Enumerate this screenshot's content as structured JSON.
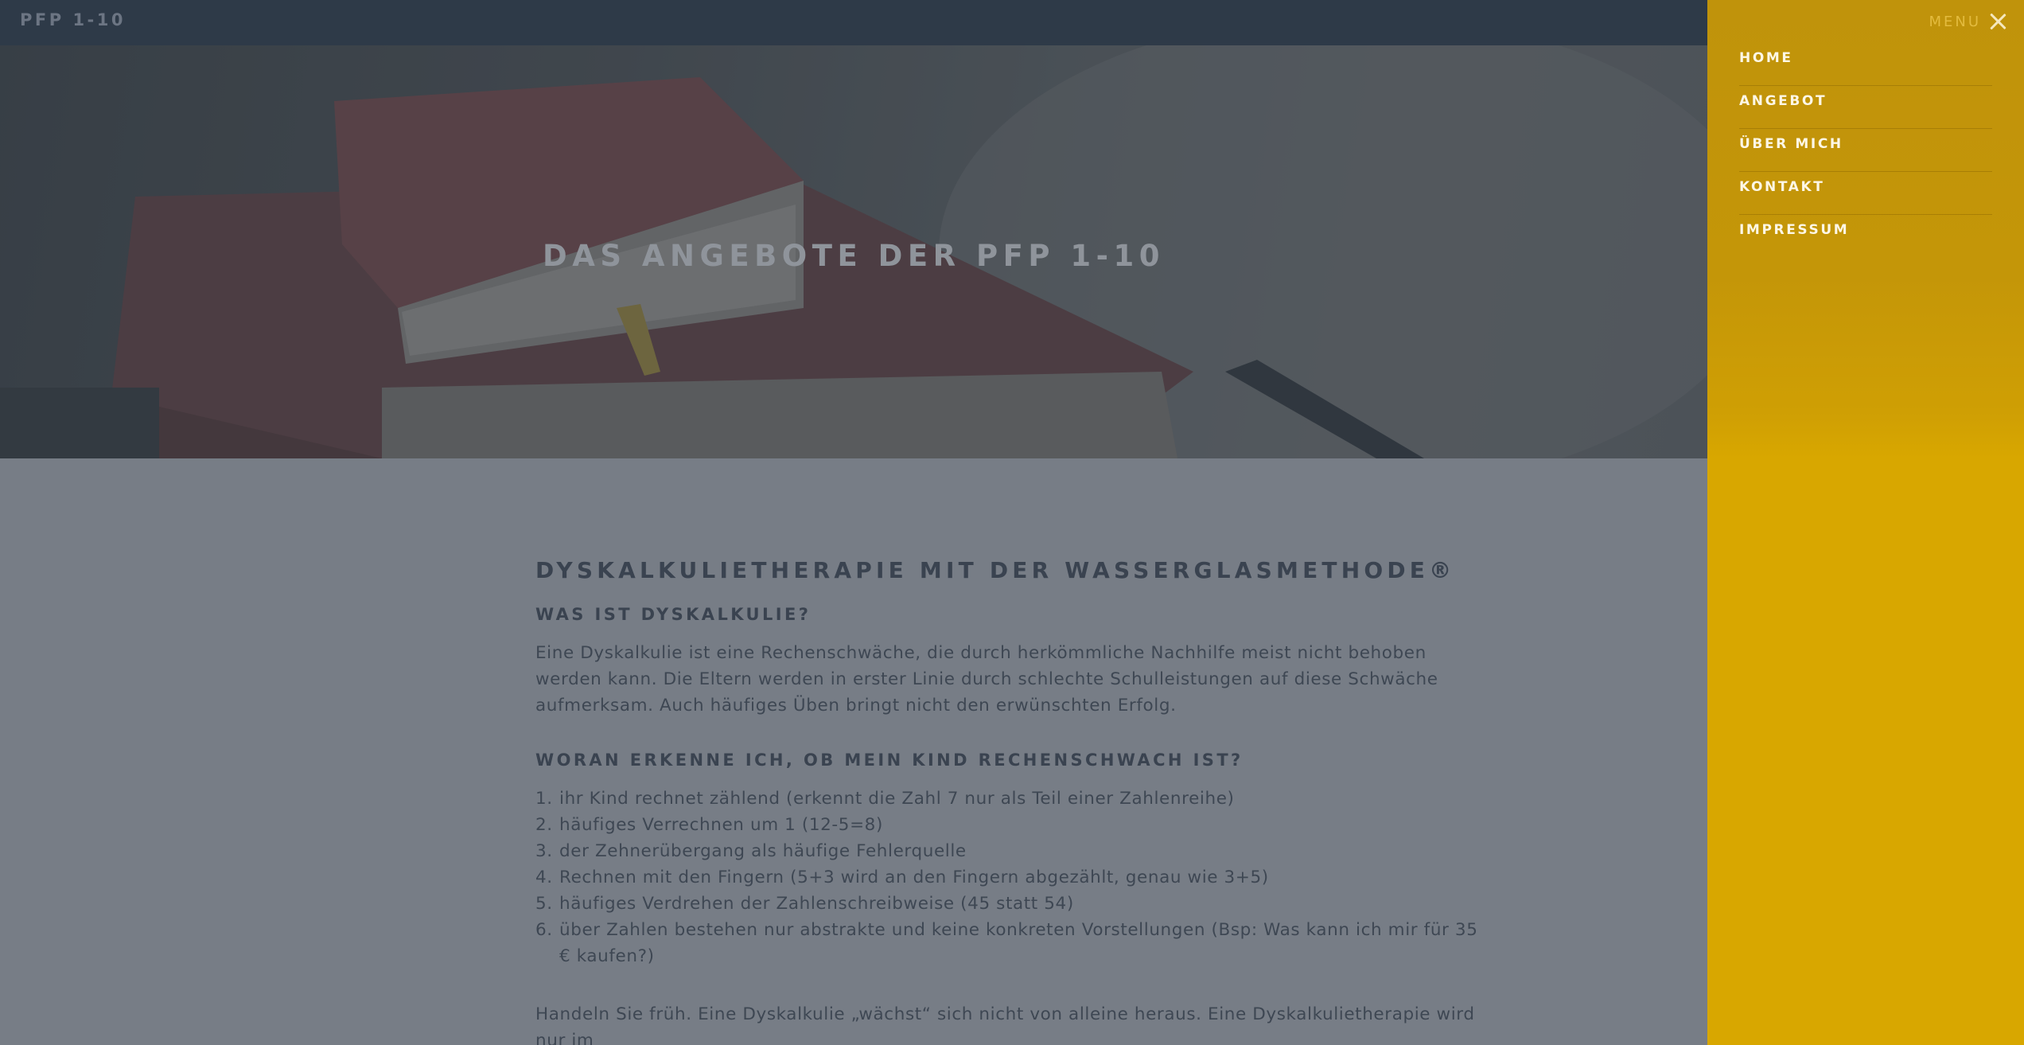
{
  "site": {
    "brand": "PFP 1-10"
  },
  "hero": {
    "title": "DAS ANGEBOTE DER PFP 1-10"
  },
  "menu": {
    "label": "MENU",
    "close_icon": "close-icon",
    "items": [
      {
        "label": "HOME"
      },
      {
        "label": "ANGEBOT"
      },
      {
        "label": "ÜBER MICH"
      },
      {
        "label": "KONTAKT"
      },
      {
        "label": "IMPRESSUM"
      }
    ]
  },
  "content": {
    "heading": "DYSKALKULIETHERAPIE MIT DER WASSERGLASMETHODE®",
    "section1": {
      "heading": "WAS IST DYSKALKULIE?",
      "text": "Eine Dyskalkulie ist eine Rechenschwäche, die durch herkömmliche Nachhilfe meist nicht behoben werden kann. Die Eltern werden in erster Linie durch schlechte Schulleistungen auf diese Schwäche aufmerksam. Auch häufiges Üben bringt nicht den erwünschten Erfolg."
    },
    "section2": {
      "heading": "WORAN ERKENNE ICH, OB MEIN KIND RECHENSCHWACH IST?",
      "items": [
        {
          "num": "1.",
          "text": "ihr Kind rechnet zählend (erkennt die Zahl 7 nur als Teil einer Zahlenreihe)"
        },
        {
          "num": "2.",
          "text": "häufiges Verrechnen um 1 (12-5=8)"
        },
        {
          "num": "3.",
          "text": "der Zehnerübergang als häufige Fehlerquelle"
        },
        {
          "num": "4.",
          "text": "Rechnen mit den Fingern (5+3 wird an den Fingern abgezählt, genau wie 3+5)"
        },
        {
          "num": "5.",
          "text": "häufiges Verdrehen der Zahlenschreibweise (45 statt 54)"
        },
        {
          "num": "6.",
          "text": "über Zahlen bestehen nur abstrakte und keine konkreten Vorstellungen (Bsp: Was kann ich mir für 35 € kaufen?)"
        }
      ]
    },
    "closing": "Handeln Sie früh. Eine Dyskalkulie „wächst“ sich nicht von alleine heraus. Eine Dyskalkulietherapie wird nur im"
  },
  "colors": {
    "topbar": "#2e3a48",
    "content_bg": "#777d86",
    "menu_bg": "#d8a700",
    "text_dark": "#3a4350"
  }
}
